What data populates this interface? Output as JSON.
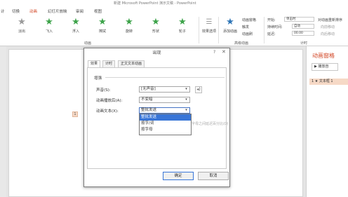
{
  "app": {
    "title": "新建 Microsoft PowerPoint 演示文稿 - PowerPoint"
  },
  "ribbon_tabs": [
    "计",
    "切换",
    "动画",
    "幻灯片放映",
    "审阅",
    "视图"
  ],
  "active_tab": "动画",
  "animation_effects": [
    {
      "label": "淡出",
      "icon": "star-icon"
    },
    {
      "label": "飞入",
      "icon": "star-icon"
    },
    {
      "label": "浮入",
      "icon": "star-icon"
    },
    {
      "label": "擦拭",
      "icon": "star-icon"
    },
    {
      "label": "旋转",
      "icon": "star-icon"
    },
    {
      "label": "形状",
      "icon": "star-icon"
    },
    {
      "label": "轮子",
      "icon": "star-icon"
    }
  ],
  "ribbon": {
    "effect_options": "效果选项",
    "add_animation": "添加动画",
    "animation_pane": "动画窗格",
    "trigger": "触发",
    "animation_painter": "动画刷",
    "group_animation": "动画",
    "group_advanced": "高级动画",
    "group_timing": "计时",
    "start_label": "开始:",
    "start_value": "单击时",
    "duration_label": "持续时间:",
    "duration_value": "自动",
    "delay_label": "延迟:",
    "delay_value": "00.00",
    "reorder_title": "对动画重新排序",
    "move_earlier": "向前移动",
    "move_later": "向后移动"
  },
  "pane": {
    "title": "动画窗格",
    "play_from": "播放自",
    "item": "1 ★ 文本框 1"
  },
  "slide": {
    "marker": "1"
  },
  "dialog": {
    "title": "出现",
    "help": "?",
    "tabs": [
      "效果",
      "计时",
      "正文文本动画"
    ],
    "active_tab_index": 0,
    "section": "增强",
    "sound_label": "声音(S):",
    "sound_value": "[无声音]",
    "after_label": "动画播放后(A):",
    "after_value": "不变暗",
    "text_label": "动画文本(X):",
    "text_value": "整批发送",
    "text_options": [
      "整批发送",
      "按字/词",
      "按字母"
    ],
    "selected_option_index": 0,
    "hidden_text": "字母之间延迟百分比(D)",
    "ok_label": "确定",
    "cancel_label": "取消"
  }
}
